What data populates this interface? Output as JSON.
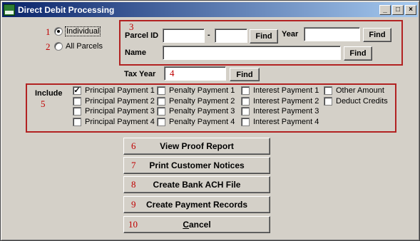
{
  "window": {
    "title": "Direct Debit Processing",
    "minimize": "_",
    "maximize": "□",
    "close": "×"
  },
  "selection": {
    "individual": {
      "num": "1",
      "label": "Individual",
      "checked": true
    },
    "all_parcels": {
      "num": "2",
      "label": "All Parcels",
      "checked": false
    }
  },
  "parcel": {
    "num": "3",
    "parcel_id_label": "Parcel ID",
    "dash": "-",
    "find_label": "Find",
    "year_label": "Year",
    "name_label": "Name"
  },
  "tax_year": {
    "label": "Tax Year",
    "num": "4",
    "find_label": "Find"
  },
  "include": {
    "label": "Include",
    "num": "5",
    "columns": [
      [
        {
          "label": "Principal Payment 1",
          "checked": true
        },
        {
          "label": "Principal Payment 2",
          "checked": false
        },
        {
          "label": "Principal Payment 3",
          "checked": false
        },
        {
          "label": "Principal Payment 4",
          "checked": false
        }
      ],
      [
        {
          "label": "Penalty Payment 1",
          "checked": false
        },
        {
          "label": "Penalty Payment 2",
          "checked": false
        },
        {
          "label": "Penalty Payment 3",
          "checked": false
        },
        {
          "label": "Penalty Payment 4",
          "checked": false
        }
      ],
      [
        {
          "label": "Interest Payment 1",
          "checked": false
        },
        {
          "label": "Interest Payment 2",
          "checked": false
        },
        {
          "label": "Interest Payment 3",
          "checked": false
        },
        {
          "label": "Interest Payment 4",
          "checked": false
        }
      ],
      [
        {
          "label": "Other Amount",
          "checked": false
        },
        {
          "label": "Deduct Credits",
          "checked": false
        }
      ]
    ]
  },
  "actions": [
    {
      "num": "6",
      "label": "View Proof Report"
    },
    {
      "num": "7",
      "label": "Print Customer Notices"
    },
    {
      "num": "8",
      "label": "Create Bank ACH File"
    },
    {
      "num": "9",
      "label": "Create Payment Records"
    },
    {
      "num": "10",
      "label_first": "C",
      "label_rest": "ancel"
    }
  ],
  "colors": {
    "annotation": "#c00000",
    "highlight_box": "#b22222",
    "titlebar_start": "#0a246a"
  }
}
